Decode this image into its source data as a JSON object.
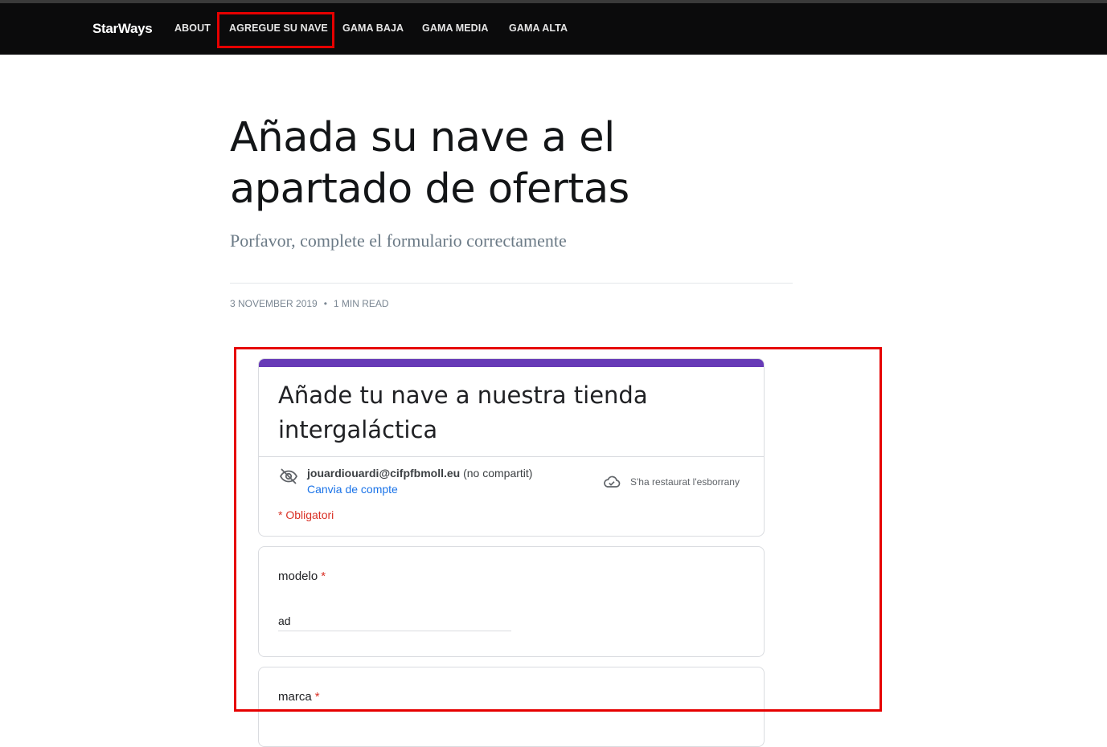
{
  "navbar": {
    "brand": "StarWays",
    "items": [
      "ABOUT",
      "AGREGUE SU NAVE",
      "GAMA BAJA",
      "GAMA MEDIA",
      "GAMA ALTA"
    ]
  },
  "post": {
    "title": "Añada su nave a el apartado de ofertas",
    "subtitle": "Porfavor, complete el formulario correctamente",
    "date": "3 NOVEMBER 2019",
    "separator": "•",
    "read_time": "1 MIN READ"
  },
  "form": {
    "title": "Añade tu nave a nuestra tienda intergaláctica",
    "account_email": "jouardiouardi@cifpfbmoll.eu",
    "account_visibility": "(no compartit)",
    "switch_account": "Canvia de compte",
    "draft_status": "S'ha restaurat l'esborrany",
    "required_note": "* Obligatori",
    "questions": [
      {
        "label": "modelo",
        "required_mark": "*",
        "value": "ad"
      },
      {
        "label": "marca",
        "required_mark": "*",
        "value": ""
      }
    ]
  },
  "icons": {
    "hidden": "eye-off-icon",
    "cloud": "cloud-check-icon"
  },
  "colors": {
    "highlight": "#e60000",
    "form_accent": "#673ab7",
    "link": "#1a73e8",
    "required": "#d93025",
    "navbar_bg": "#0b0b0c"
  }
}
